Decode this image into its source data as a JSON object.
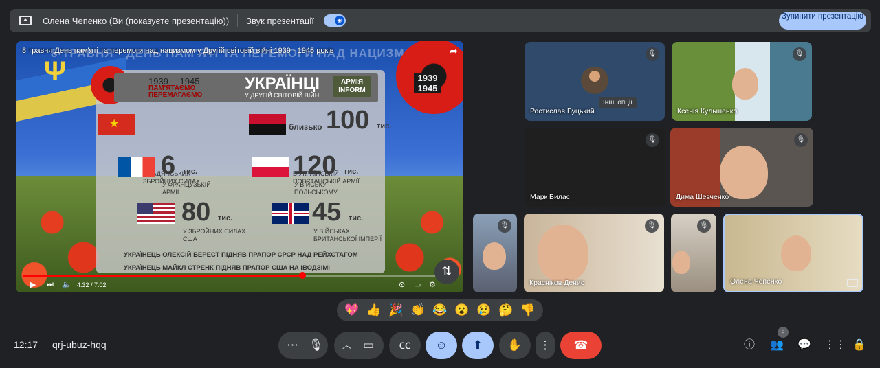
{
  "topbar": {
    "presenter": "Олена Чепенко (Ви (показуєте презентацію))",
    "sound_label": "Звук презентації",
    "stop_label": "Зупинити презентацію"
  },
  "video": {
    "title": "8 травня День пам'яті та перемоги над нацизмом у Другій світовій війні 1939 - 1945 років",
    "headline": "8 ТРАВНЯ · ДЕНЬ ПАМ'ЯТІ ТА ПЕРЕМОГИ НАД НАЦИЗМОМ",
    "poppy_years": "1939 1945",
    "card": {
      "years": "1939 —1945",
      "remember": "ПАМ'ЯТАЄМО ПЕРЕМАГАЄМО",
      "ukr": "УКРАЇНЦІ",
      "ukr_sub": "У ДРУГІЙ СВІТОВІЙ ВІЙНІ",
      "army": "АРМІЯ INFORM",
      "stats": [
        {
          "pre": "",
          "num": "",
          "unit": "",
          "label": "У РАДЯНСЬКИХ\nЗБРОЙНИХ СИЛАХ"
        },
        {
          "pre": "близько",
          "num": "100",
          "unit": "тис.",
          "label": "В УКРАЇНСЬКІЙ\nПОВСТАНСЬКІЙ АРМІЇ"
        },
        {
          "pre": "",
          "num": "6",
          "unit": "тис.",
          "label": "У ФРАНЦУЗЬКІЙ\nАРМІЇ"
        },
        {
          "pre": "",
          "num": "120",
          "unit": "тис.",
          "label": "У ВІЙСЬКУ\nПОЛЬСЬКОМУ"
        },
        {
          "pre": "",
          "num": "80",
          "unit": "тис.",
          "label": "У ЗБРОЙНИХ СИЛАХ\nСША"
        },
        {
          "pre": "",
          "num": "45",
          "unit": "тис.",
          "label": "У ВІЙСЬКАХ\nБРИТАНСЬКОЇ ІМПЕРІЇ"
        }
      ],
      "foot1": "УКРАЇНЕЦЬ ОЛЕКСІЙ БЕРЕСТ ПІДНЯВ ПРАПОР СРСР НАД РЕЙХСТАГОМ",
      "foot2": "УКРАЇНЕЦЬ МАЙКЛ СТРЕНК ПІДНЯВ ПРАПОР США НА ІВОДЗІМІ"
    },
    "time": "4:32 / 7:02",
    "progress": 0.645
  },
  "participants": [
    {
      "name": "Ростислав Буцький"
    },
    {
      "name": "Ксенія Кульшенко"
    },
    {
      "name": "Марк Билас"
    },
    {
      "name": "Дима Шевченко"
    },
    {
      "name": ""
    },
    {
      "name": "Красніков Денис"
    },
    {
      "name": ""
    },
    {
      "name": "Олена Чепенко"
    }
  ],
  "tooltip": "Інші опції",
  "reactions": [
    "💖",
    "👍",
    "🎉",
    "👏",
    "😂",
    "😮",
    "😢",
    "🤔",
    "👎"
  ],
  "meeting": {
    "time": "12:17",
    "code": "qrj-ubuz-hqq"
  },
  "people_count": "9"
}
